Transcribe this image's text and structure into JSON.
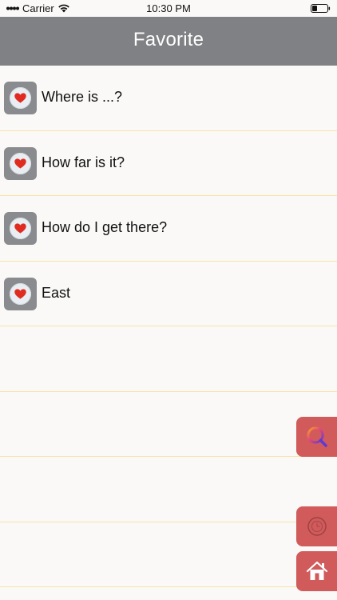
{
  "status_bar": {
    "carrier": "Carrier",
    "time": "10:30 PM"
  },
  "nav": {
    "title": "Favorite"
  },
  "favorites": [
    {
      "text": "Where is ...?"
    },
    {
      "text": "How far is it?"
    },
    {
      "text": "How do I get there?"
    },
    {
      "text": "East"
    }
  ],
  "empty_rows": 4,
  "side_actions": [
    {
      "icon": "search-icon"
    },
    {
      "icon": "timer-icon"
    },
    {
      "icon": "home-icon"
    }
  ],
  "colors": {
    "nav_background": "#808184",
    "row_divider": "#f8e3a6",
    "action_button": "#d15a5b",
    "heart": "#e02b20"
  }
}
